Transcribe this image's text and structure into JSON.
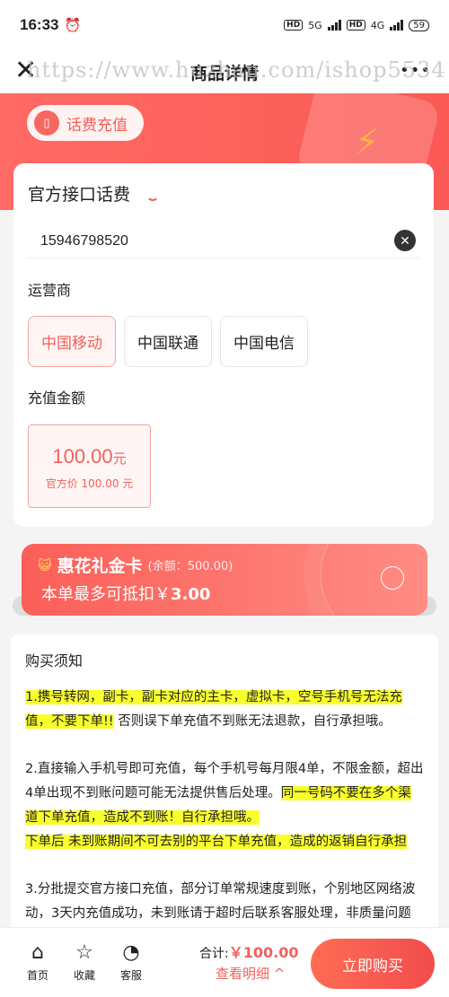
{
  "status_bar": {
    "time": "16:33",
    "alarm_icon": "alarm-icon",
    "net1": "5G",
    "net2": "4G",
    "battery": "59"
  },
  "nav": {
    "title": "商品详情",
    "close_icon": "close-icon",
    "more_icon": "more-icon"
  },
  "watermark": "https://www.huzhan.com/ishop5534",
  "hero": {
    "badge": "话费充值",
    "bolt_icon": "lightning-icon"
  },
  "form": {
    "heading": "官方接口话费",
    "phone_value": "15946798520",
    "operator_label": "运营商",
    "operators": [
      "中国移动",
      "中国联通",
      "中国电信"
    ],
    "selected_operator": "中国移动",
    "amount_label": "充值金额",
    "amount_value": "100.00",
    "amount_unit": "元",
    "amount_official": "官方价 100.00 元"
  },
  "gift_card": {
    "title": "惠花礼金卡",
    "balance": "(余额：500.00)",
    "deduct_prefix": "本单最多可抵扣￥",
    "deduct_value": "3.00"
  },
  "notice": {
    "title": "购买须知",
    "p1_hl": "1.携号转网，副卡，副卡对应的主卡，虚拟卡，空号手机号无法充值，不要下单!!",
    "p1_rest": " 否则误下单充值不到账无法退款，自行承担哦。",
    "p2_plain": "2.直接输入手机号即可充值，每个手机号每月限4单，不限金额，超出4单出现不到账问题可能无法提供售后处理。",
    "p2_hl1": "同一号码不要在多个渠道下单充值，造成不到账！自行承担哦。",
    "p2_hl2": "下单后 未到账期间不可去别的平台下单充值，造成的返销自行承担",
    "p3": "3.分批提交官方接口充值，部分订单常规速度到账，个别地区网络波动，3天内充值成功，未到账请于超时后联系客服处理，非质量问题不可退"
  },
  "bottom": {
    "home": "首页",
    "favorite": "收藏",
    "service": "客服",
    "total_label": "合计:",
    "total_value": "￥100.00",
    "detail": "查看明细 ^",
    "buy": "立即购买"
  }
}
